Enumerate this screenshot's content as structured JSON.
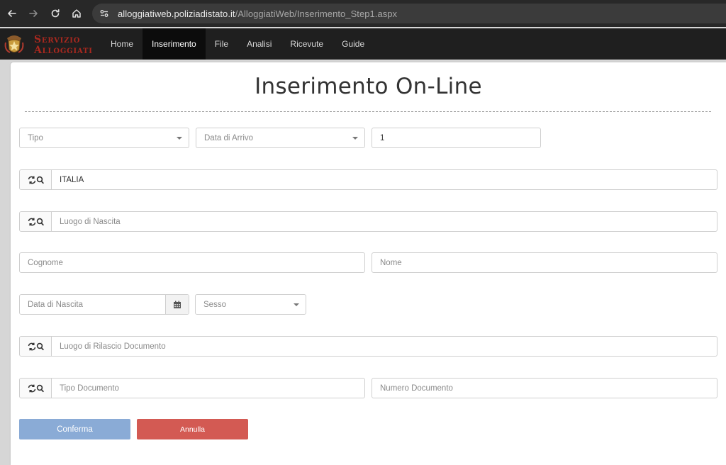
{
  "browser": {
    "url_domain": "alloggiatiweb.poliziadistato.it",
    "url_path": "/AlloggiatiWeb/Inserimento_Step1.aspx"
  },
  "brand": {
    "line1": "Servizio",
    "line2": "Alloggiati"
  },
  "menu": {
    "items": [
      {
        "label": "Home"
      },
      {
        "label": "Inserimento"
      },
      {
        "label": "File"
      },
      {
        "label": "Analisi"
      },
      {
        "label": "Ricevute"
      },
      {
        "label": "Guide"
      }
    ],
    "active_index": 1
  },
  "page": {
    "title": "Inserimento On-Line"
  },
  "form": {
    "tipo": {
      "placeholder": "Tipo"
    },
    "data_arrivo": {
      "placeholder": "Data di Arrivo"
    },
    "giorni": {
      "value": "1"
    },
    "stato": {
      "value": "ITALIA"
    },
    "luogo_nascita": {
      "placeholder": "Luogo di Nascita"
    },
    "cognome": {
      "placeholder": "Cognome"
    },
    "nome": {
      "placeholder": "Nome"
    },
    "data_nascita": {
      "placeholder": "Data di Nascita"
    },
    "sesso": {
      "placeholder": "Sesso"
    },
    "luogo_rilascio": {
      "placeholder": "Luogo di Rilascio Documento"
    },
    "tipo_documento": {
      "placeholder": "Tipo Documento"
    },
    "numero_documento": {
      "placeholder": "Numero Documento"
    }
  },
  "buttons": {
    "confirm": "Conferma",
    "cancel": "Annulla"
  },
  "colors": {
    "navbar": "#1f1f1f",
    "brand_red": "#a8281f",
    "confirm_blue": "#8aabd6",
    "cancel_red": "#d35a53"
  },
  "icons": {
    "back": "arrow-left-icon",
    "forward": "arrow-right-icon",
    "reload": "reload-icon",
    "home": "home-icon",
    "site_info": "tune-icon",
    "search_refresh": "refresh-search-icon",
    "calendar": "calendar-icon",
    "emblem": "police-emblem-icon"
  }
}
